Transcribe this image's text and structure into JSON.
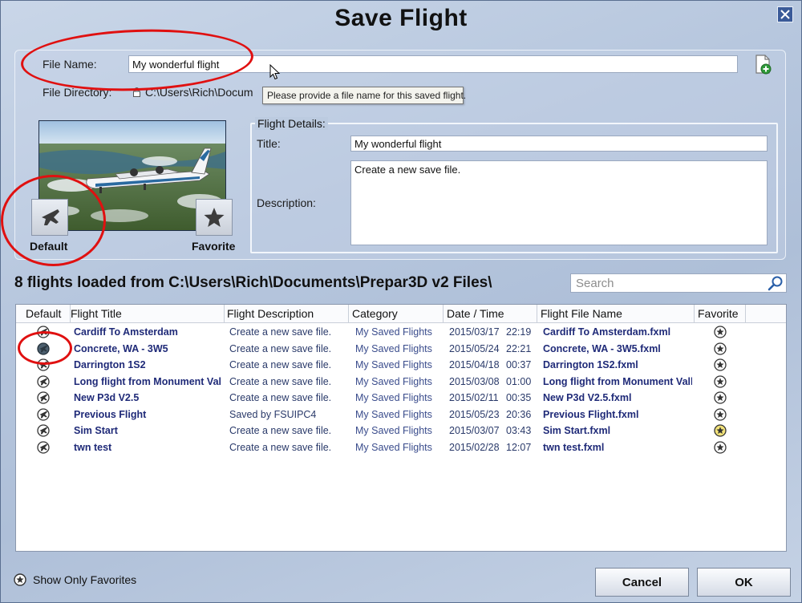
{
  "dialog": {
    "title": "Save Flight"
  },
  "file": {
    "name_label": "File Name:",
    "name_value": "My wonderful flight",
    "dir_label": "File Directory:",
    "dir_value": "C:\\Users\\Rich\\Docum",
    "tooltip": "Please provide a file name for this saved flight."
  },
  "thumbnail": {
    "default_label": "Default",
    "favorite_label": "Favorite"
  },
  "details": {
    "legend": "Flight Details:",
    "title_label": "Title:",
    "title_value": "My wonderful flight",
    "desc_label": "Description:",
    "desc_value": "Create a new save file."
  },
  "list": {
    "heading": "8 flights loaded from C:\\Users\\Rich\\Documents\\Prepar3D v2 Files\\",
    "search_placeholder": "Search",
    "columns": [
      "Default",
      "Flight Title",
      "Flight Description",
      "Category",
      "Date / Time",
      "Flight File Name",
      "Favorite"
    ],
    "rows": [
      {
        "default_selected": false,
        "title": "Cardiff To Amsterdam",
        "description": "Create a new save file.",
        "category": "My Saved Flights",
        "date": "2015/03/17",
        "time": "22:19",
        "file": "Cardiff To Amsterdam.fxml",
        "favorite": false
      },
      {
        "default_selected": true,
        "title": "Concrete, WA - 3W5",
        "description": "Create a new save file.",
        "category": "My Saved Flights",
        "date": "2015/05/24",
        "time": "22:21",
        "file": "Concrete, WA - 3W5.fxml",
        "favorite": false
      },
      {
        "default_selected": false,
        "title": "Darrington 1S2",
        "description": "Create a new save file.",
        "category": "My Saved Flights",
        "date": "2015/04/18",
        "time": "00:37",
        "file": "Darrington 1S2.fxml",
        "favorite": false
      },
      {
        "default_selected": false,
        "title": "Long flight from Monument Valle",
        "description": "Create a new save file.",
        "category": "My Saved Flights",
        "date": "2015/03/08",
        "time": "01:00",
        "file": "Long flight from Monument Valle",
        "favorite": false
      },
      {
        "default_selected": false,
        "title": "New P3d V2.5",
        "description": "Create a new save file.",
        "category": "My Saved Flights",
        "date": "2015/02/11",
        "time": "00:35",
        "file": "New P3d V2.5.fxml",
        "favorite": false
      },
      {
        "default_selected": false,
        "title": "Previous Flight",
        "description": "Saved by FSUIPC4",
        "category": "My Saved Flights",
        "date": "2015/05/23",
        "time": "20:36",
        "file": "Previous Flight.fxml",
        "favorite": false
      },
      {
        "default_selected": false,
        "title": "Sim Start",
        "description": "Create a new save file.",
        "category": "My Saved Flights",
        "date": "2015/03/07",
        "time": "03:43",
        "file": "Sim Start.fxml",
        "favorite": true
      },
      {
        "default_selected": false,
        "title": "twn test",
        "description": "Create a new save file.",
        "category": "My Saved Flights",
        "date": "2015/02/28",
        "time": "12:07",
        "file": "twn test.fxml",
        "favorite": false
      }
    ]
  },
  "footer": {
    "favorites_only_label": "Show Only Favorites",
    "cancel_label": "Cancel",
    "ok_label": "OK"
  },
  "colors": {
    "accent": "#3a5a98",
    "annotation": "#e01010",
    "favorite_star": "#f3e37a"
  }
}
